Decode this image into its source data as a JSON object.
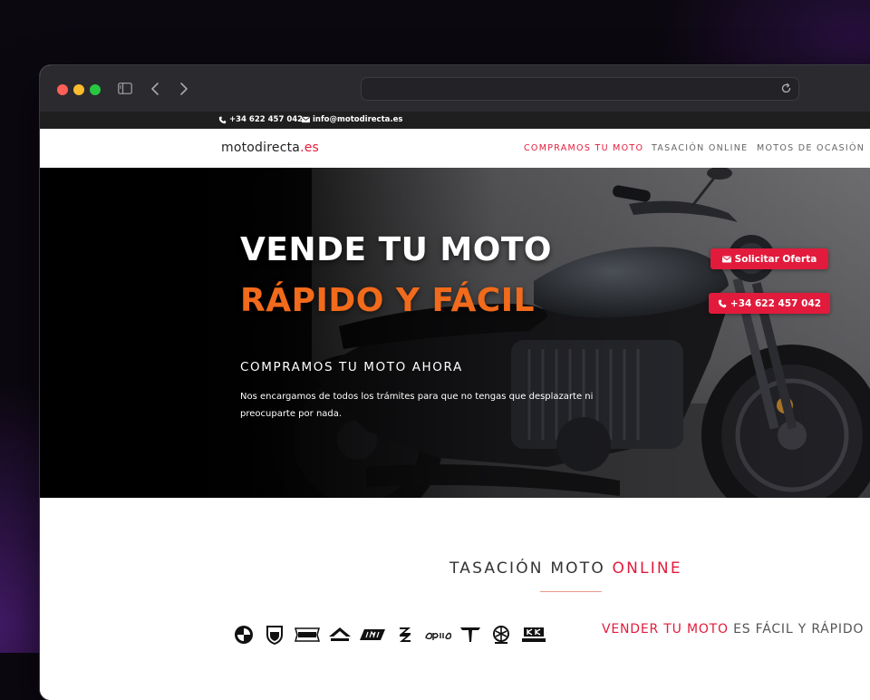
{
  "topbar": {
    "phone": "+34 622 457 042",
    "email": "info@motodirecta.es"
  },
  "header": {
    "logo_name": "motodirecta",
    "logo_tld": ".es",
    "menu": [
      {
        "label": "COMPRAMOS TU MOTO",
        "active": true
      },
      {
        "label": "TASACIÓN ONLINE",
        "active": false
      },
      {
        "label": "MOTOS DE OCASIÓN",
        "active": false
      }
    ]
  },
  "hero": {
    "title_line1": "VENDE TU MOTO",
    "title_line2": "RÁPIDO Y FÁCIL",
    "subtitle": "COMPRAMOS TU MOTO AHORA",
    "description": "Nos encargamos de todos los trámites para que no tengas que desplazarte ni preocuparte por nada.",
    "offer_button": "Solicitar Oferta",
    "call_button": "+34 622 457 042"
  },
  "section": {
    "title_main": "TASACIÓN MOTO ",
    "title_accent": "ONLINE",
    "tagline_accent": "VENDER TU MOTO",
    "tagline_rest": " ES FÁCIL Y RÁPIDO",
    "brands": [
      "BMW",
      "DUCATI",
      "HARLEY-DAVIDSON",
      "HONDA",
      "KTM",
      "SUZUKI",
      "aprilia",
      "TRIUMPH",
      "YAMAHA",
      "Kawasaki"
    ]
  },
  "colors": {
    "accent": "#e21b3c",
    "orange": "#f26a1b",
    "topbar": "#1f1f20"
  }
}
